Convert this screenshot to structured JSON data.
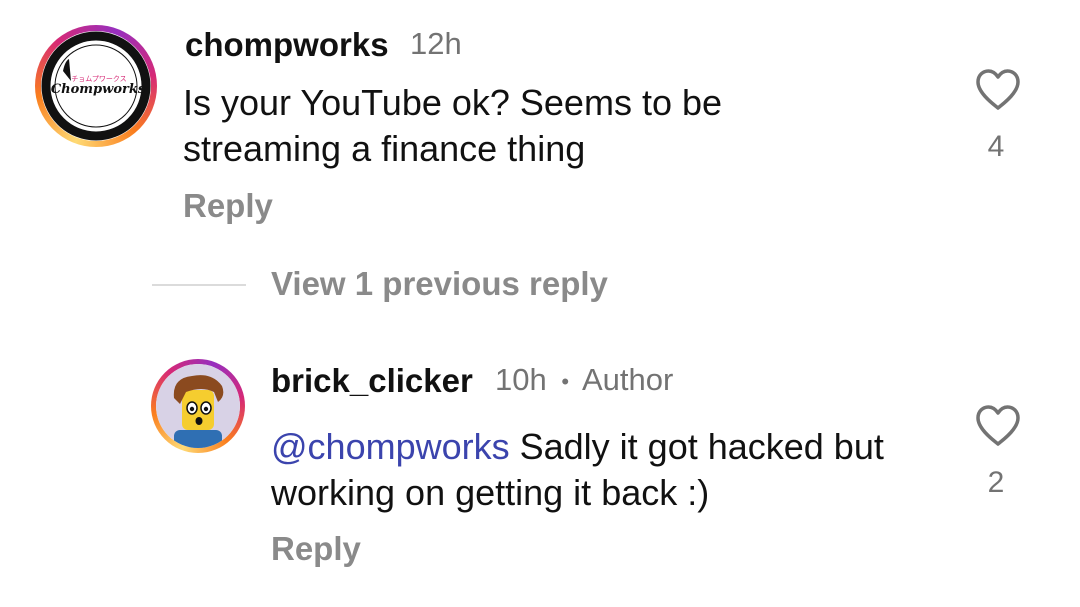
{
  "comments": [
    {
      "username": "chompworks",
      "time": "12h",
      "text": "Is your YouTube ok? Seems to be streaming a finance thing",
      "reply_label": "Reply",
      "likes": "4",
      "avatar_logo_text": "Chompworks",
      "avatar_logo_subtext": "チョムプワークス"
    },
    {
      "username": "brick_clicker",
      "time": "10h",
      "separator": "•",
      "badge": "Author",
      "mention": "@chompworks",
      "text": " Sadly it got hacked but working on getting it back :)",
      "reply_label": "Reply",
      "likes": "2"
    }
  ],
  "thread": {
    "view_replies_label": "View 1 previous reply"
  },
  "colors": {
    "mention": "#3b44ad",
    "muted": "#737373"
  }
}
